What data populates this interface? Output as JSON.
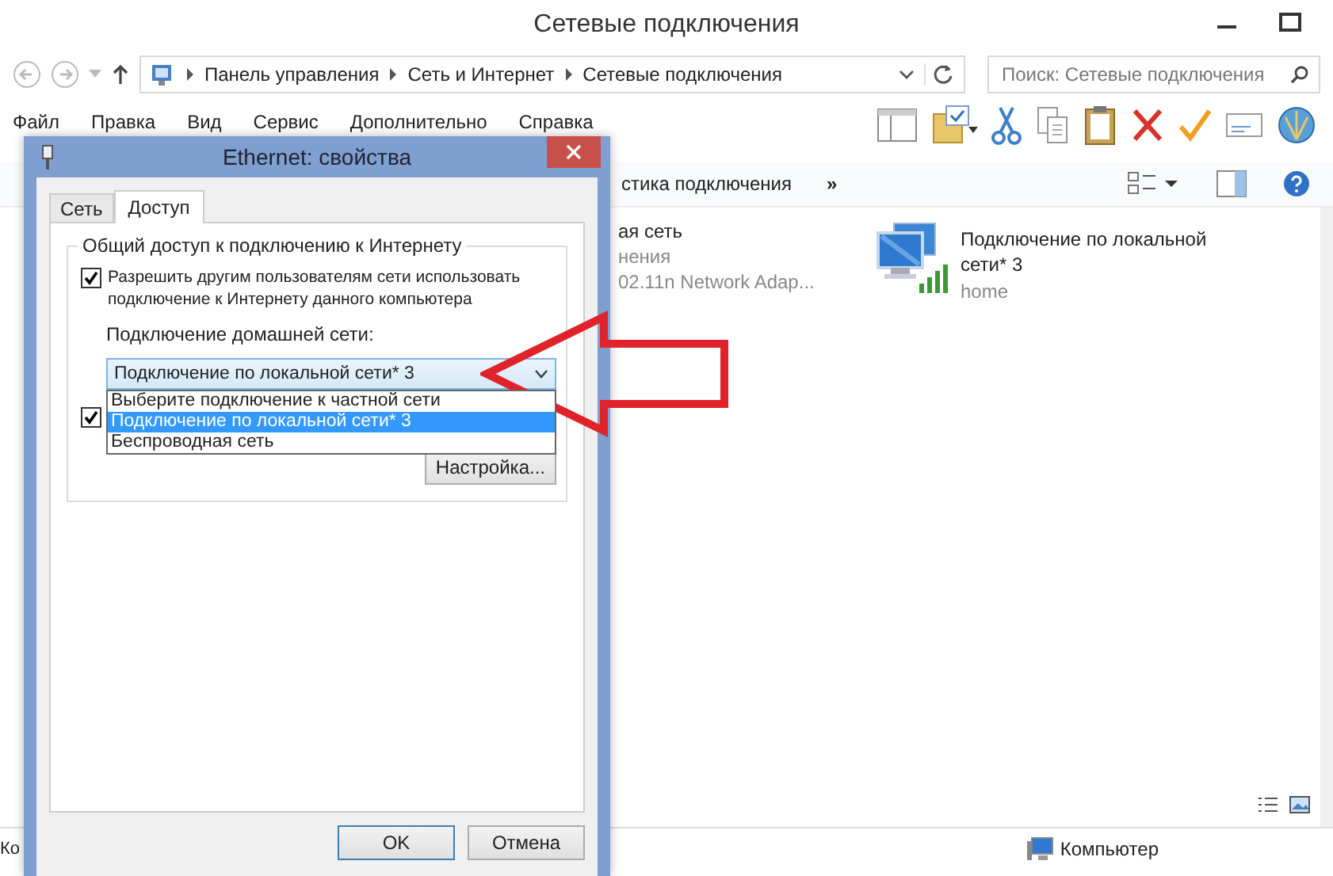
{
  "window": {
    "title": "Сетевые подключения"
  },
  "address": {
    "crumbs": [
      "Панель управления",
      "Сеть и Интернет",
      "Сетевые подключения"
    ]
  },
  "search": {
    "placeholder": "Поиск: Сетевые подключения"
  },
  "menu": [
    "Файл",
    "Правка",
    "Вид",
    "Сервис",
    "Дополнительно",
    "Справка"
  ],
  "command_bar": {
    "items": [
      "стика подключения",
      "»"
    ]
  },
  "connections": [
    {
      "kind": "partial",
      "name": "ая сеть",
      "status": "нения",
      "device": "02.11n Network Adap..."
    },
    {
      "kind": "full",
      "name": "Подключение по локальной сети* 3",
      "status": "home"
    }
  ],
  "status_bar": {
    "left": "Ко",
    "right": "Компьютер"
  },
  "dialog": {
    "title": "Ethernet: свойства",
    "tabs": [
      {
        "label": "Сеть",
        "selected": false
      },
      {
        "label": "Доступ",
        "selected": true
      }
    ],
    "group_title": "Общий доступ к подключению к Интернету",
    "allow_sharing": {
      "label": "Разрешить другим пользователям сети использовать подключение к Интернету данного компьютера",
      "checked": true
    },
    "home_network": {
      "label": "Подключение домашней сети:",
      "value": "Подключение по локальной сети* 3",
      "expanded": true,
      "options": [
        {
          "label": "Выберите подключение к частной сети",
          "selected": false
        },
        {
          "label": "Подключение по локальной сети* 3",
          "selected": true
        },
        {
          "label": "Беспроводная сеть",
          "selected": false
        }
      ]
    },
    "allow_control": {
      "checked": true
    },
    "settings_button": "Настройка...",
    "buttons": [
      "OK",
      "Отмена"
    ]
  }
}
